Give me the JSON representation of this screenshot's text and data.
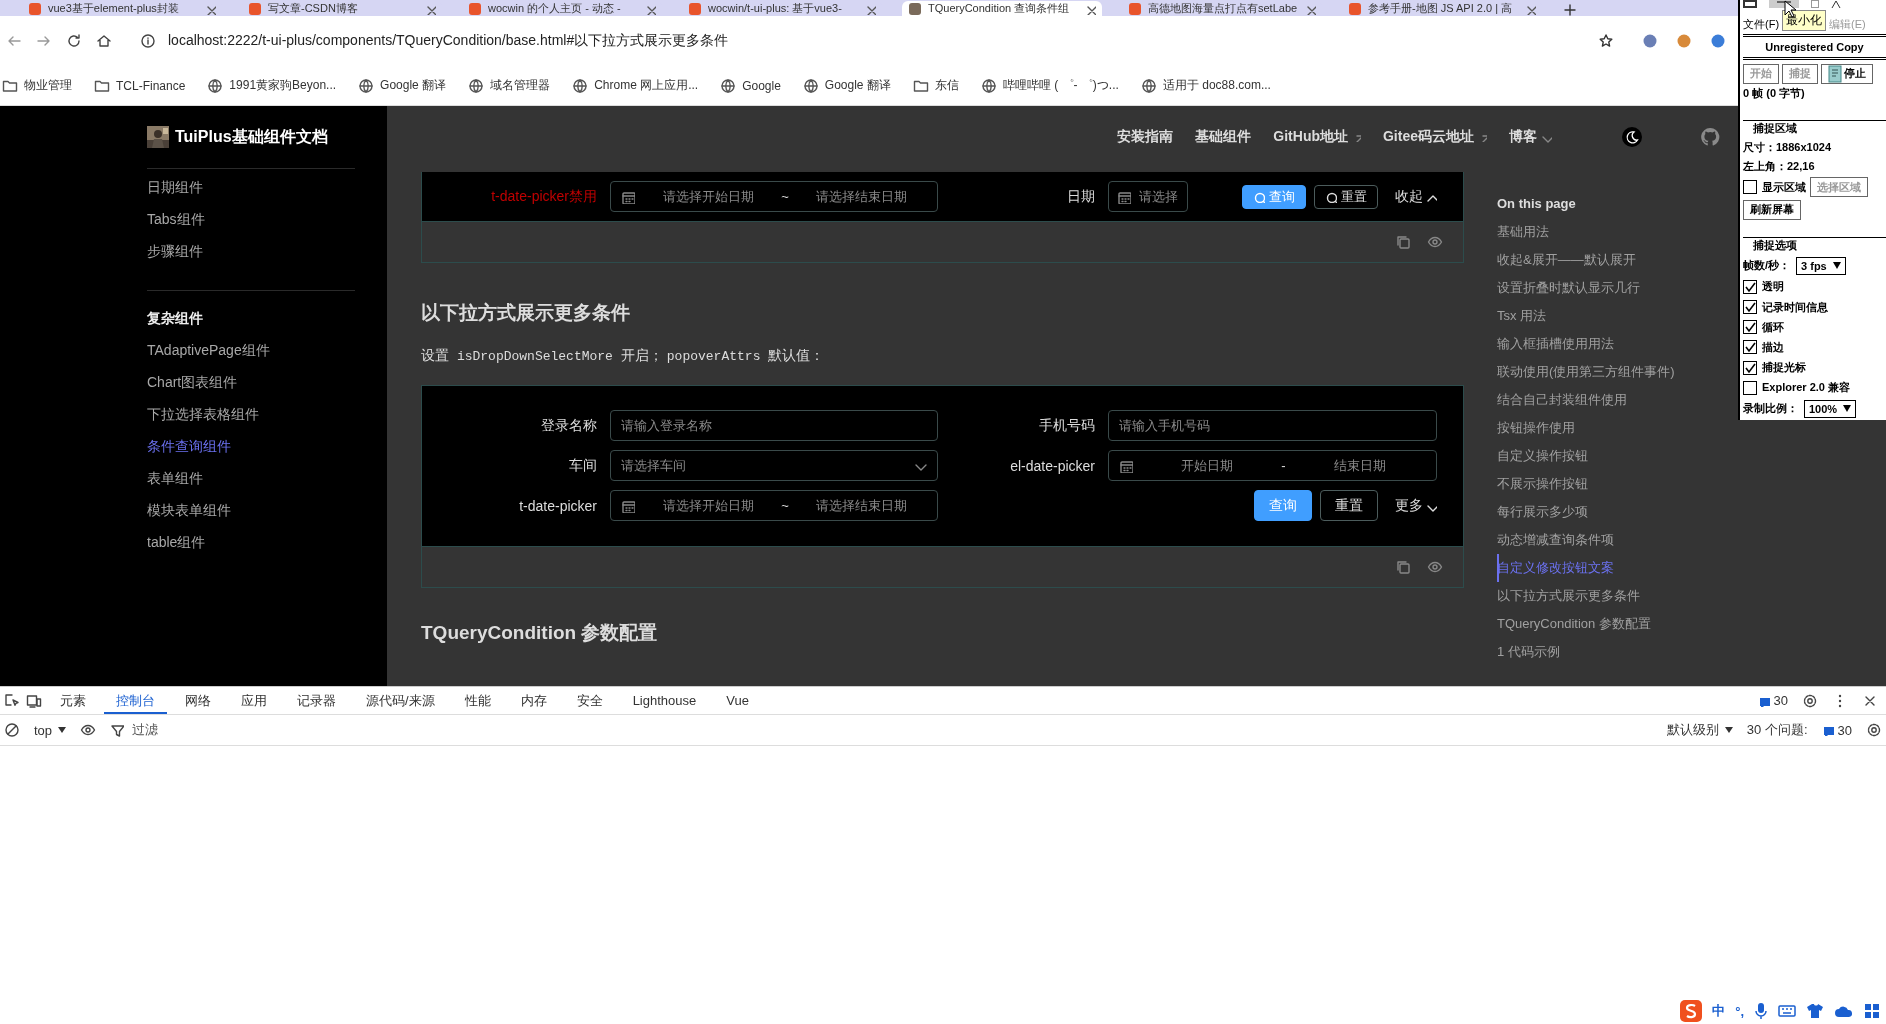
{
  "browser_tabs": [
    {
      "title": "vue3基于element-plus封装",
      "selected": false
    },
    {
      "title": "写文章-CSDN博客",
      "selected": false
    },
    {
      "title": "wocwin 的个人主页 - 动态 -",
      "selected": false
    },
    {
      "title": "wocwin/t-ui-plus: 基于vue3-",
      "selected": false
    },
    {
      "title": "TQueryCondition 查询条件组",
      "selected": true
    },
    {
      "title": "高德地图海量点打点有setLabe",
      "selected": false
    },
    {
      "title": "参考手册-地图 JS API 2.0 | 高",
      "selected": false
    }
  ],
  "address_bar": {
    "url": "localhost:2222/t-ui-plus/components/TQueryCondition/base.html#以下拉方式展示更多条件"
  },
  "bookmarks": [
    {
      "label": "物业管理",
      "kind": "folder"
    },
    {
      "label": "TCL-Finance",
      "kind": "folder"
    },
    {
      "label": "1991黄家驹Beyon...",
      "kind": "site"
    },
    {
      "label": "Google 翻译",
      "kind": "site"
    },
    {
      "label": "域名管理器",
      "kind": "site"
    },
    {
      "label": "Chrome 网上应用...",
      "kind": "site"
    },
    {
      "label": "Google",
      "kind": "site"
    },
    {
      "label": "Google 翻译",
      "kind": "site"
    },
    {
      "label": "东信",
      "kind": "folder"
    },
    {
      "label": "哔哩哔哩 ( ゜- ゜)つ...",
      "kind": "site"
    },
    {
      "label": "适用于 doc88.com...",
      "kind": "site"
    }
  ],
  "site_title": "TuiPlus基础组件文档",
  "nav": [
    {
      "label": "安装指南",
      "kind": "link"
    },
    {
      "label": "基础组件",
      "kind": "link"
    },
    {
      "label": "GitHub地址",
      "kind": "external"
    },
    {
      "label": "Gitee码云地址",
      "kind": "external"
    },
    {
      "label": "博客",
      "kind": "dropdown"
    }
  ],
  "sidebar": {
    "sections": [
      {
        "items": [
          {
            "label": "日期组件",
            "selected": false
          },
          {
            "label": "Tabs组件",
            "selected": false
          },
          {
            "label": "步骤组件",
            "selected": false
          }
        ]
      },
      {
        "heading": "复杂组件",
        "items": [
          {
            "label": "TAdaptivePage组件",
            "selected": false
          },
          {
            "label": "Chart图表组件",
            "selected": false
          },
          {
            "label": "下拉选择表格组件",
            "selected": false
          },
          {
            "label": "条件查询组件",
            "selected": true
          },
          {
            "label": "表单组件",
            "selected": false
          },
          {
            "label": "模块表单组件",
            "selected": false
          },
          {
            "label": "table组件",
            "selected": false
          }
        ]
      }
    ]
  },
  "top_demo": {
    "fields": [
      {
        "label": "t-date-picker禁用",
        "highlighted": true,
        "kind": "date_range",
        "start_placeholder": "请选择开始日期",
        "separator": "~",
        "end_placeholder": "请选择结束日期"
      },
      {
        "label": "日期",
        "highlighted": false,
        "kind": "date",
        "placeholder": "请选择"
      }
    ],
    "buttons": [
      {
        "label": "查询",
        "kind": "primary",
        "with_icon": true
      },
      {
        "label": "重置",
        "kind": "default",
        "with_icon": true
      }
    ],
    "toggle": "收起"
  },
  "section": {
    "heading": "以下拉方式展示更多条件",
    "description": [
      {
        "text": "设置 ",
        "kind": "text"
      },
      {
        "text": "isDropDownSelectMore",
        "kind": "code"
      },
      {
        "text": " 开启；",
        "kind": "text"
      },
      {
        "text": "popoverAttrs",
        "kind": "code"
      },
      {
        "text": " 默认值：",
        "kind": "text"
      }
    ],
    "demo": {
      "fields": [
        {
          "label": "登录名称",
          "kind": "input",
          "placeholder": "请输入登录名称"
        },
        {
          "label": "手机号码",
          "kind": "input",
          "placeholder": "请输入手机号码"
        },
        {
          "label": "车间",
          "kind": "select",
          "placeholder": "请选择车间"
        },
        {
          "label": "el-date-picker",
          "kind": "date_range",
          "start_placeholder": "开始日期",
          "separator": "-",
          "end_placeholder": "结束日期"
        },
        {
          "label": "t-date-picker",
          "kind": "date_range",
          "start_placeholder": "请选择开始日期",
          "separator": "~",
          "end_placeholder": "请选择结束日期"
        }
      ],
      "buttons": [
        {
          "label": "查询",
          "kind": "primary",
          "with_icon": false
        },
        {
          "label": "重置",
          "kind": "default",
          "with_icon": false
        }
      ],
      "toggle": "更多"
    }
  },
  "next_heading": "TQueryCondition 参数配置",
  "toc": {
    "title": "On this page",
    "items": [
      {
        "label": "基础用法",
        "selected": false
      },
      {
        "label": "收起&展开——默认展开",
        "selected": false
      },
      {
        "label": "设置折叠时默认显示几行",
        "selected": false
      },
      {
        "label": "Tsx 用法",
        "selected": false
      },
      {
        "label": "输入框插槽使用用法",
        "selected": false
      },
      {
        "label": "联动使用(使用第三方组件事件)",
        "selected": false
      },
      {
        "label": "结合自己封装组件使用",
        "selected": false
      },
      {
        "label": "按钮操作使用",
        "selected": false
      },
      {
        "label": "自定义操作按钮",
        "selected": false
      },
      {
        "label": "不展示操作按钮",
        "selected": false
      },
      {
        "label": "每行展示多少项",
        "selected": false
      },
      {
        "label": "动态增减查询条件项",
        "selected": false
      },
      {
        "label": "自定义修改按钮文案",
        "selected": true
      },
      {
        "label": "以下拉方式展示更多条件",
        "selected": false
      },
      {
        "label": "TQueryCondition 参数配置",
        "selected": false
      },
      {
        "label": "1 代码示例",
        "selected": false
      }
    ]
  },
  "devtools": {
    "tabs": [
      {
        "label": "元素",
        "selected": false
      },
      {
        "label": "控制台",
        "selected": true
      },
      {
        "label": "网络",
        "selected": false
      },
      {
        "label": "应用",
        "selected": false
      },
      {
        "label": "记录器",
        "selected": false
      },
      {
        "label": "源代码/来源",
        "selected": false
      },
      {
        "label": "性能",
        "selected": false
      },
      {
        "label": "内存",
        "selected": false
      },
      {
        "label": "安全",
        "selected": false
      },
      {
        "label": "Lighthouse",
        "selected": false
      },
      {
        "label": "Vue",
        "selected": false
      }
    ],
    "message_count": "30",
    "context": "top",
    "filter_placeholder": "过滤",
    "level": "默认级别",
    "issues_label": "30 个问题:",
    "issues_count": "30"
  },
  "capture_tool": {
    "tooltip": "最小化",
    "menus": [
      "文件(F)",
      "编辑(E)"
    ],
    "banner": "Unregistered Copy",
    "buttons": [
      {
        "label": "开始",
        "disabled": true
      },
      {
        "label": "捕捉",
        "disabled": true
      },
      {
        "label": "停止",
        "disabled": false
      }
    ],
    "frames": "0 帧 (0 字节)",
    "area": {
      "title": "捕捉区域",
      "size": "尺寸：1886x1024",
      "origin": "左上角：22,16",
      "show_area": {
        "label": "显示区域",
        "checked": false
      },
      "select_button": {
        "label": "选择区域",
        "disabled": true
      },
      "refresh_button": "刷新屏幕"
    },
    "options": {
      "title": "捕捉选项",
      "fps_label": "帧数/秒：",
      "fps": "3 fps",
      "checkboxes": [
        {
          "label": "透明",
          "checked": true
        },
        {
          "label": "记录时间信息",
          "checked": true
        },
        {
          "label": "循环",
          "checked": true
        },
        {
          "label": "描边",
          "checked": true
        },
        {
          "label": "捕捉光标",
          "checked": true
        },
        {
          "label": "Explorer 2.0 兼容",
          "checked": false
        }
      ],
      "scale_label": "录制比例：",
      "scale": "100%"
    }
  },
  "ime_bar": [
    {
      "kind": "logo"
    },
    {
      "kind": "text",
      "text": "中"
    },
    {
      "kind": "text",
      "text": "°,"
    },
    {
      "kind": "mic"
    },
    {
      "kind": "keyboard"
    },
    {
      "kind": "shirt"
    },
    {
      "kind": "cloud"
    },
    {
      "kind": "grid"
    }
  ]
}
